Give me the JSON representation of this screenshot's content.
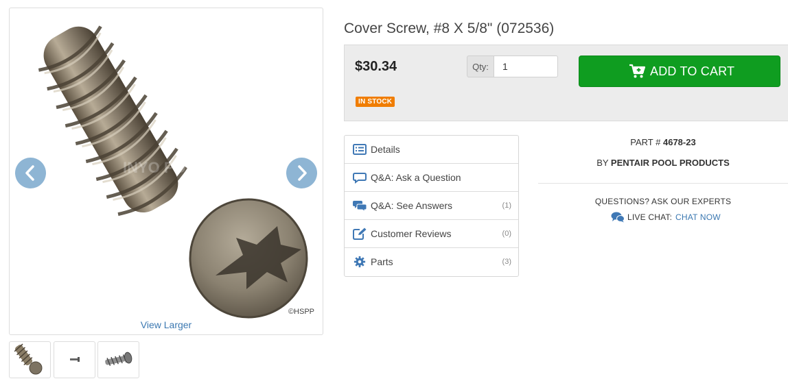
{
  "gallery": {
    "view_larger": "View Larger",
    "copyright": "©HSPP",
    "watermark": "INYO POOLS .COM",
    "prev_icon": "chevron-left-icon",
    "next_icon": "chevron-right-icon"
  },
  "product": {
    "title": "Cover Screw, #8 X 5/8\" (072536)",
    "price": "$30.34",
    "stock_badge": "IN STOCK",
    "qty_label": "Qty:",
    "qty_value": "1",
    "add_to_cart": "ADD TO CART",
    "part_prefix": "PART #",
    "part_number": "4678-23",
    "brand_prefix": "BY",
    "brand": "PENTAIR POOL PRODUCTS"
  },
  "menu": [
    {
      "label": "Details",
      "count": "",
      "icon": "list-icon"
    },
    {
      "label": "Q&A: Ask a Question",
      "count": "",
      "icon": "speech-bubble-icon"
    },
    {
      "label": "Q&A: See Answers",
      "count": "(1)",
      "icon": "speech-bubbles-icon"
    },
    {
      "label": "Customer Reviews",
      "count": "(0)",
      "icon": "edit-icon"
    },
    {
      "label": "Parts",
      "count": "(3)",
      "icon": "gear-icon"
    }
  ],
  "support": {
    "questions": "QUESTIONS? ASK OUR EXPERTS",
    "live_chat": "LIVE CHAT:",
    "chat_now": "CHAT NOW"
  },
  "colors": {
    "accent_green": "#0f9d20",
    "badge_orange": "#f07d00",
    "link_blue": "#3b78b1",
    "icon_blue": "#3f78b5"
  }
}
